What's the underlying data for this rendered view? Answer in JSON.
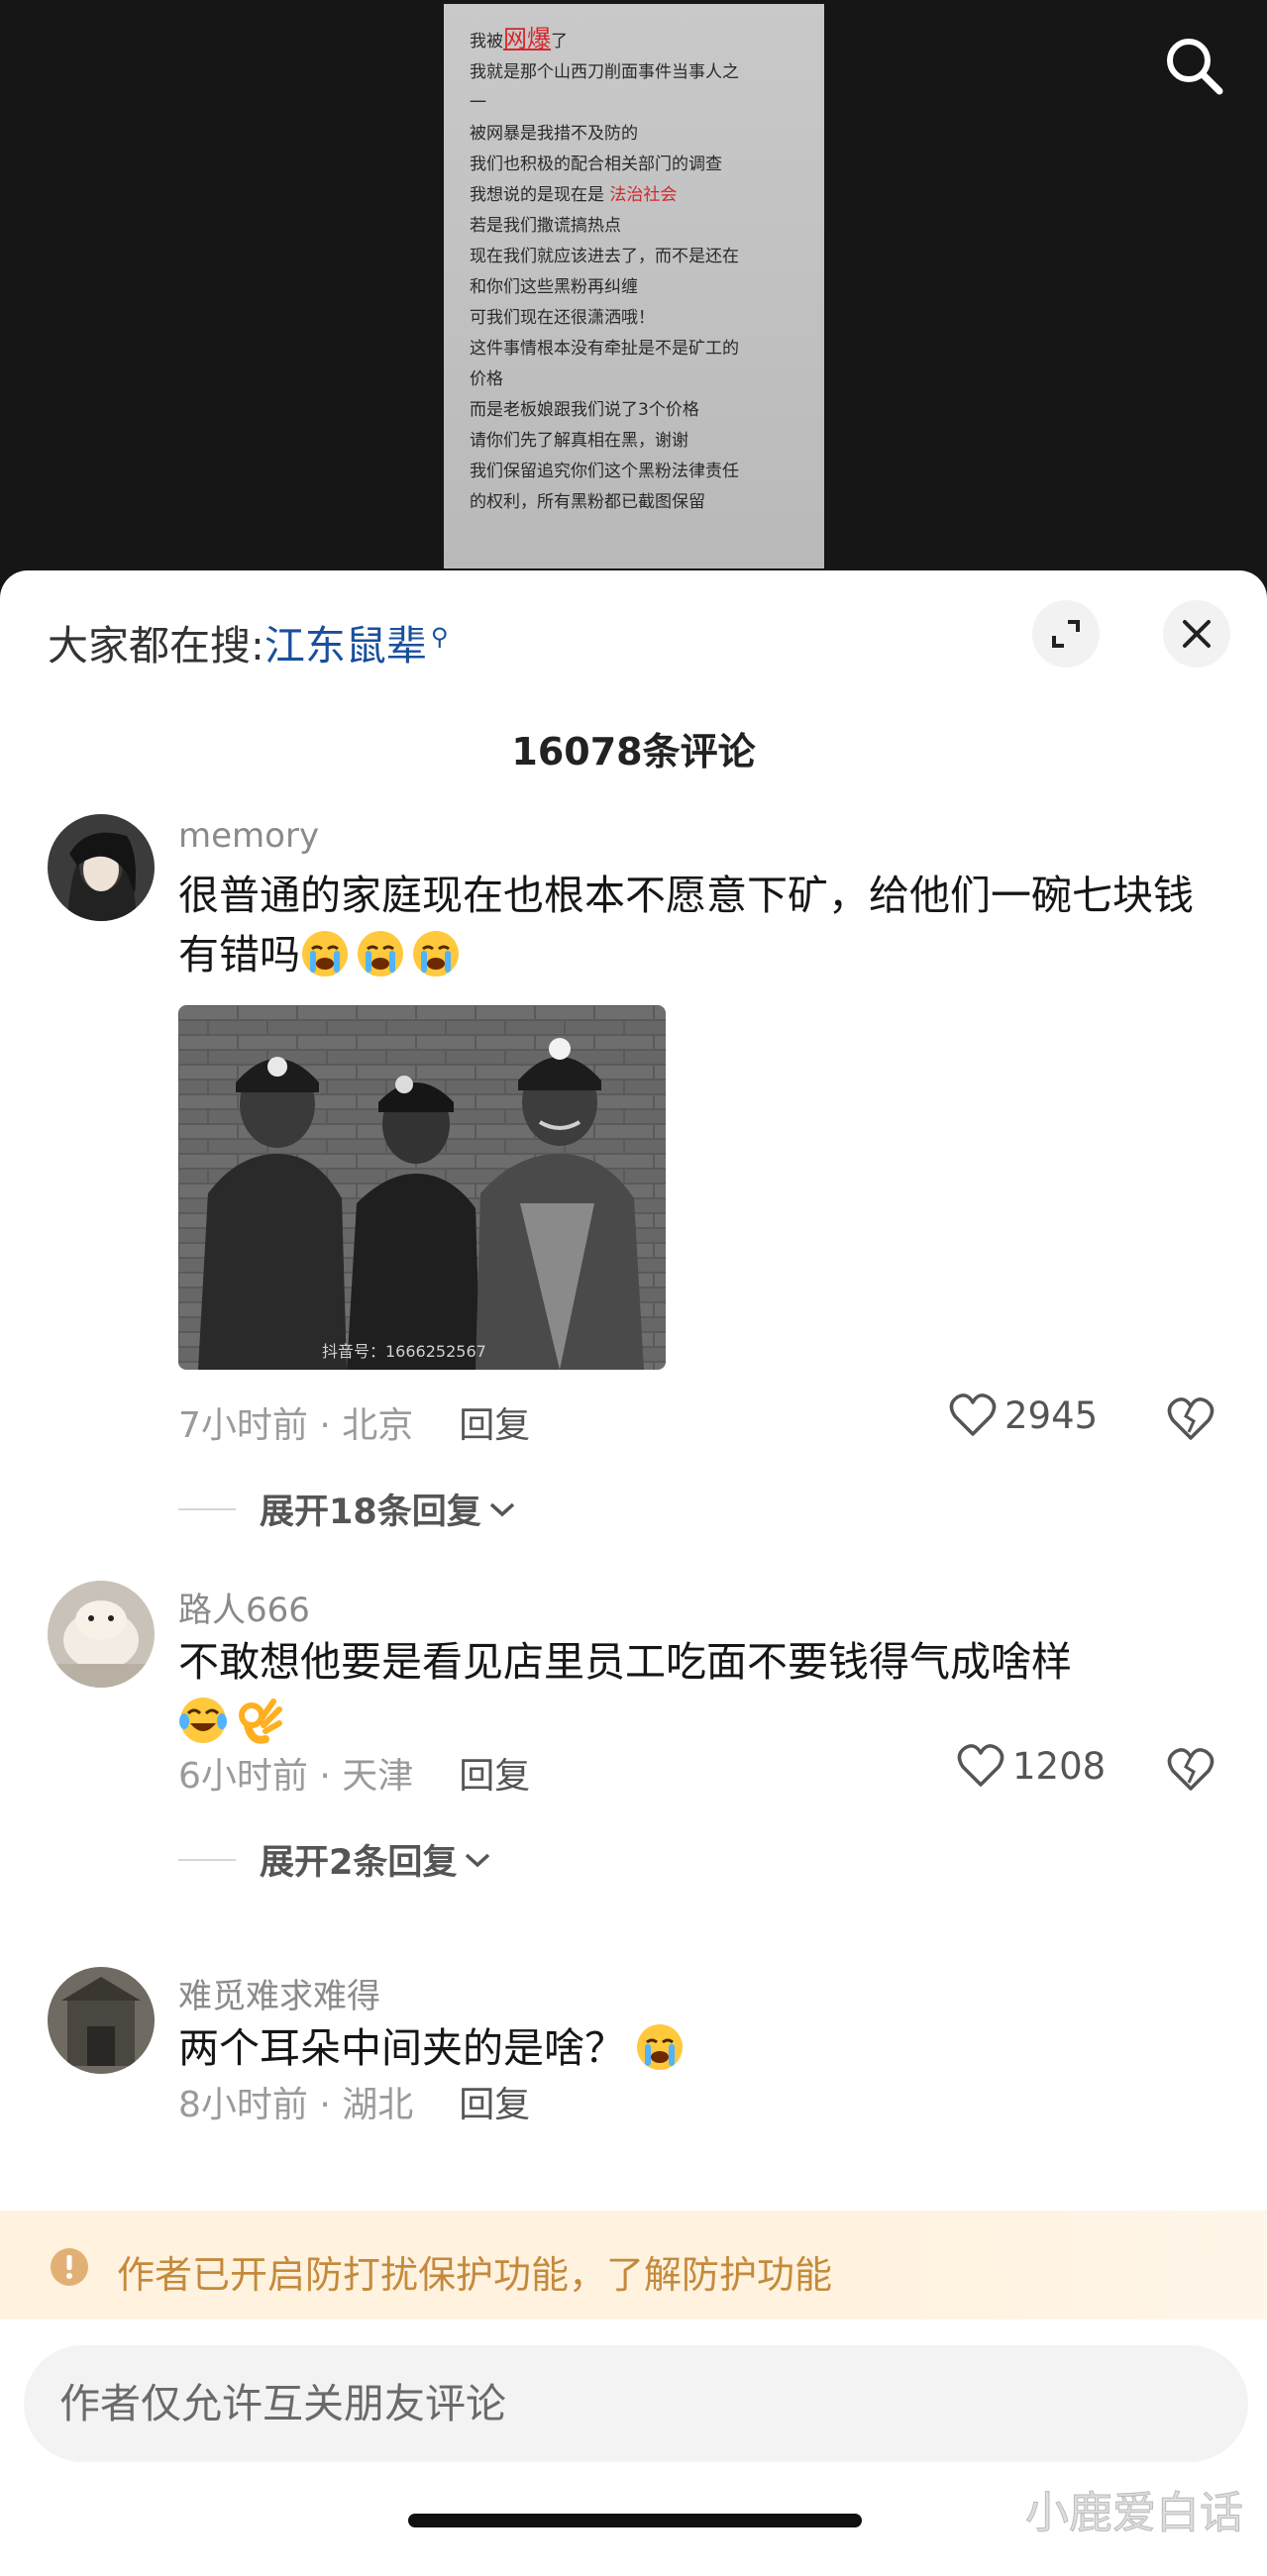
{
  "video_note": {
    "lines": [
      {
        "t": "我被",
        "r": "网爆",
        "t2": "了"
      },
      {
        "t": "我就是那个山西刀削面事件当事人之"
      },
      {
        "t": "一"
      },
      {
        "t": "被网暴是我措不及防的"
      },
      {
        "t": "我们也积极的配合相关部门的调查"
      },
      {
        "t": "我想说的是现在是  ",
        "r2": "法治社会"
      },
      {
        "t": "若是我们撒谎搞热点"
      },
      {
        "t": "现在我们就应该进去了，而不是还在"
      },
      {
        "t": "和你们这些黑粉再纠缠"
      },
      {
        "t": "可我们现在还很潇洒哦！"
      },
      {
        "t": "这件事情根本没有牵扯是不是矿工的"
      },
      {
        "t": "价格"
      },
      {
        "t": "而是老板娘跟我们说了3个价格"
      },
      {
        "t": "请你们先了解真相在黑，谢谢"
      },
      {
        "t": "我们保留追究你们这个黑粉法律责任"
      },
      {
        "t": "的权利，所有黑粉都已截图保留"
      }
    ]
  },
  "search_hint": {
    "prefix": "大家都在搜:",
    "keyword": "江东鼠辈"
  },
  "comment_count": "16078条评论",
  "comments": [
    {
      "user": "memory",
      "text": "很普通的家庭现在也根本不愿意下矿，给他们一碗七块钱有错吗",
      "time": "7小时前 · 北京",
      "reply": "回复",
      "likes": "2945",
      "expand": "展开18条回复",
      "photo_watermark": "抖音号：1666252567"
    },
    {
      "user": "路人666",
      "text": "不敢想他要是看见店里员工吃面不要钱得气成啥样",
      "time": "6小时前 · 天津",
      "reply": "回复",
      "likes": "1208",
      "expand": "展开2条回复"
    },
    {
      "user": "难觅难求难得",
      "text": "两个耳朵中间夹的是啥？",
      "time": "8小时前 · 湖北",
      "reply": "回复"
    }
  ],
  "protection_banner": "作者已开启防打扰保护功能，了解防护功能",
  "input_placeholder": "作者仅允许互关朋友评论",
  "site_watermark": "小鹿爱白话"
}
